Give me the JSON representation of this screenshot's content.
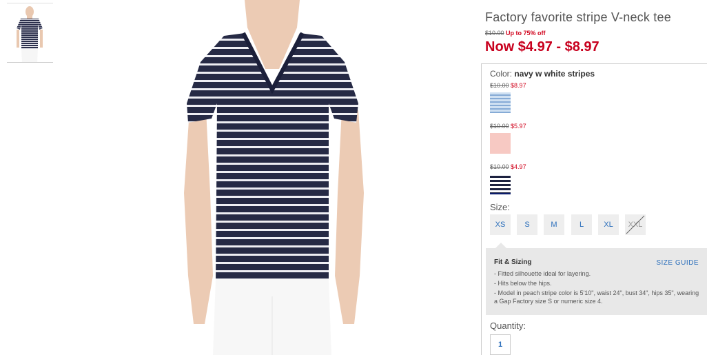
{
  "product": {
    "title": "Factory favorite stripe V-neck tee",
    "original_price": "$10.00",
    "promo": "Up to 75% off",
    "now_price": "Now $4.97 - $8.97"
  },
  "color": {
    "label": "Color:",
    "selected": "navy w white stripes",
    "swatches": [
      {
        "name": "blue stripe",
        "original": "$10.00",
        "sale": "$8.97"
      },
      {
        "name": "peach stripe",
        "original": "$10.00",
        "sale": "$5.97"
      },
      {
        "name": "navy w white stripes",
        "original": "$10.00",
        "sale": "$4.97"
      }
    ]
  },
  "size": {
    "label": "Size:",
    "options": [
      "XS",
      "S",
      "M",
      "L",
      "XL",
      "XXL"
    ],
    "unavailable": [
      "XXL"
    ]
  },
  "fit": {
    "title": "Fit & Sizing",
    "size_guide": "SIZE GUIDE",
    "bullets": [
      "- Fitted silhouette ideal for layering.",
      "- Hits below the hips.",
      "- Model in peach stripe color is 5'10\", waist 24\", bust 34\", hips 35\", wearing a Gap Factory size S or numeric size 4."
    ]
  },
  "quantity": {
    "label": "Quantity:",
    "value": "1"
  },
  "colors": {
    "sale_red": "#d0021b",
    "link_blue": "#2a6ebb",
    "navy": "#1d2240"
  }
}
